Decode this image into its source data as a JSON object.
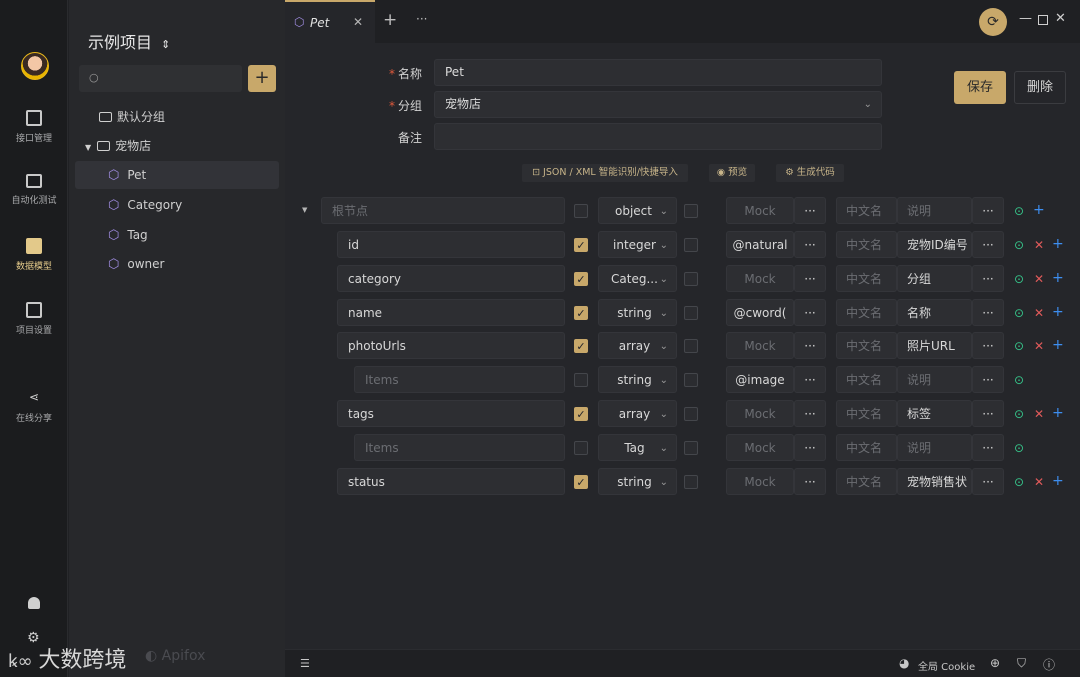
{
  "rail": {
    "items": [
      {
        "label": "接口管理",
        "icon": "api-management-icon"
      },
      {
        "label": "自动化测试",
        "icon": "automation-test-icon"
      },
      {
        "label": "数据模型",
        "icon": "data-model-icon",
        "active": true
      },
      {
        "label": "项目设置",
        "icon": "project-settings-icon"
      },
      {
        "label": "在线分享",
        "icon": "share-icon"
      }
    ]
  },
  "sidebar": {
    "project_name": "示例项目",
    "project_chevron": "⌃",
    "add_label": "+",
    "tree": [
      {
        "label": "默认分组",
        "type": "folder"
      },
      {
        "label": "宠物店",
        "type": "folder",
        "expanded": true
      },
      {
        "label": "Pet",
        "type": "model",
        "selected": true
      },
      {
        "label": "Category",
        "type": "model"
      },
      {
        "label": "Tag",
        "type": "model"
      },
      {
        "label": "owner",
        "type": "model"
      }
    ]
  },
  "tabs": {
    "active_tab": "Pet",
    "close": "✕",
    "new": "+",
    "more": "···"
  },
  "form": {
    "name_label": "名称",
    "name_value": "Pet",
    "group_label": "分组",
    "group_value": "宠物店",
    "note_label": "备注",
    "note_value": "",
    "required_mark": "*",
    "save_label": "保存",
    "delete_label": "删除",
    "import_label": "JSON / XML 智能识别/快捷导入",
    "preview_label": "预览",
    "codegen_label": "生成代码"
  },
  "schema": {
    "root": {
      "name": "根节点",
      "type": "object",
      "mock": "Mock",
      "cn": "中文名",
      "desc": "说明"
    },
    "rows": [
      {
        "name": "id",
        "required": true,
        "type": "integer",
        "mock": "@natural",
        "cn": "中文名",
        "desc": "宠物ID编号",
        "level": 1,
        "actions": "gxb"
      },
      {
        "name": "category",
        "required": true,
        "type": "Categ...",
        "mock": "Mock",
        "cn": "中文名",
        "desc": "分组",
        "level": 1,
        "actions": "gxb"
      },
      {
        "name": "name",
        "required": true,
        "type": "string",
        "mock": "@cword(",
        "cn": "中文名",
        "desc": "名称",
        "level": 1,
        "actions": "gxb"
      },
      {
        "name": "photoUrls",
        "required": true,
        "type": "array",
        "mock": "Mock",
        "cn": "中文名",
        "desc": "照片URL",
        "level": 1,
        "actions": "gxb"
      },
      {
        "name": "Items",
        "required": false,
        "type": "string",
        "mock": "@image",
        "cn": "中文名",
        "desc": "说明",
        "level": 2,
        "actions": "g"
      },
      {
        "name": "tags",
        "required": true,
        "type": "array",
        "mock": "Mock",
        "cn": "中文名",
        "desc": "标签",
        "level": 1,
        "actions": "gxb"
      },
      {
        "name": "Items",
        "required": false,
        "type": "Tag",
        "mock": "Mock",
        "cn": "中文名",
        "desc": "说明",
        "level": 2,
        "actions": "g"
      },
      {
        "name": "status",
        "required": true,
        "type": "string",
        "mock": "Mock",
        "cn": "中文名",
        "desc": "宠物销售状",
        "level": 1,
        "actions": "gxb"
      }
    ],
    "more": "···"
  },
  "status_bar": {
    "cookie_label": "全局 Cookie"
  },
  "watermark": {
    "text": "大数跨境",
    "brand": "Apifox"
  },
  "colors": {
    "accent": "#c8a86a",
    "required": "#e05a3c",
    "add": "#36c48a",
    "remove": "#e05a5a",
    "child": "#3d8ef0"
  }
}
